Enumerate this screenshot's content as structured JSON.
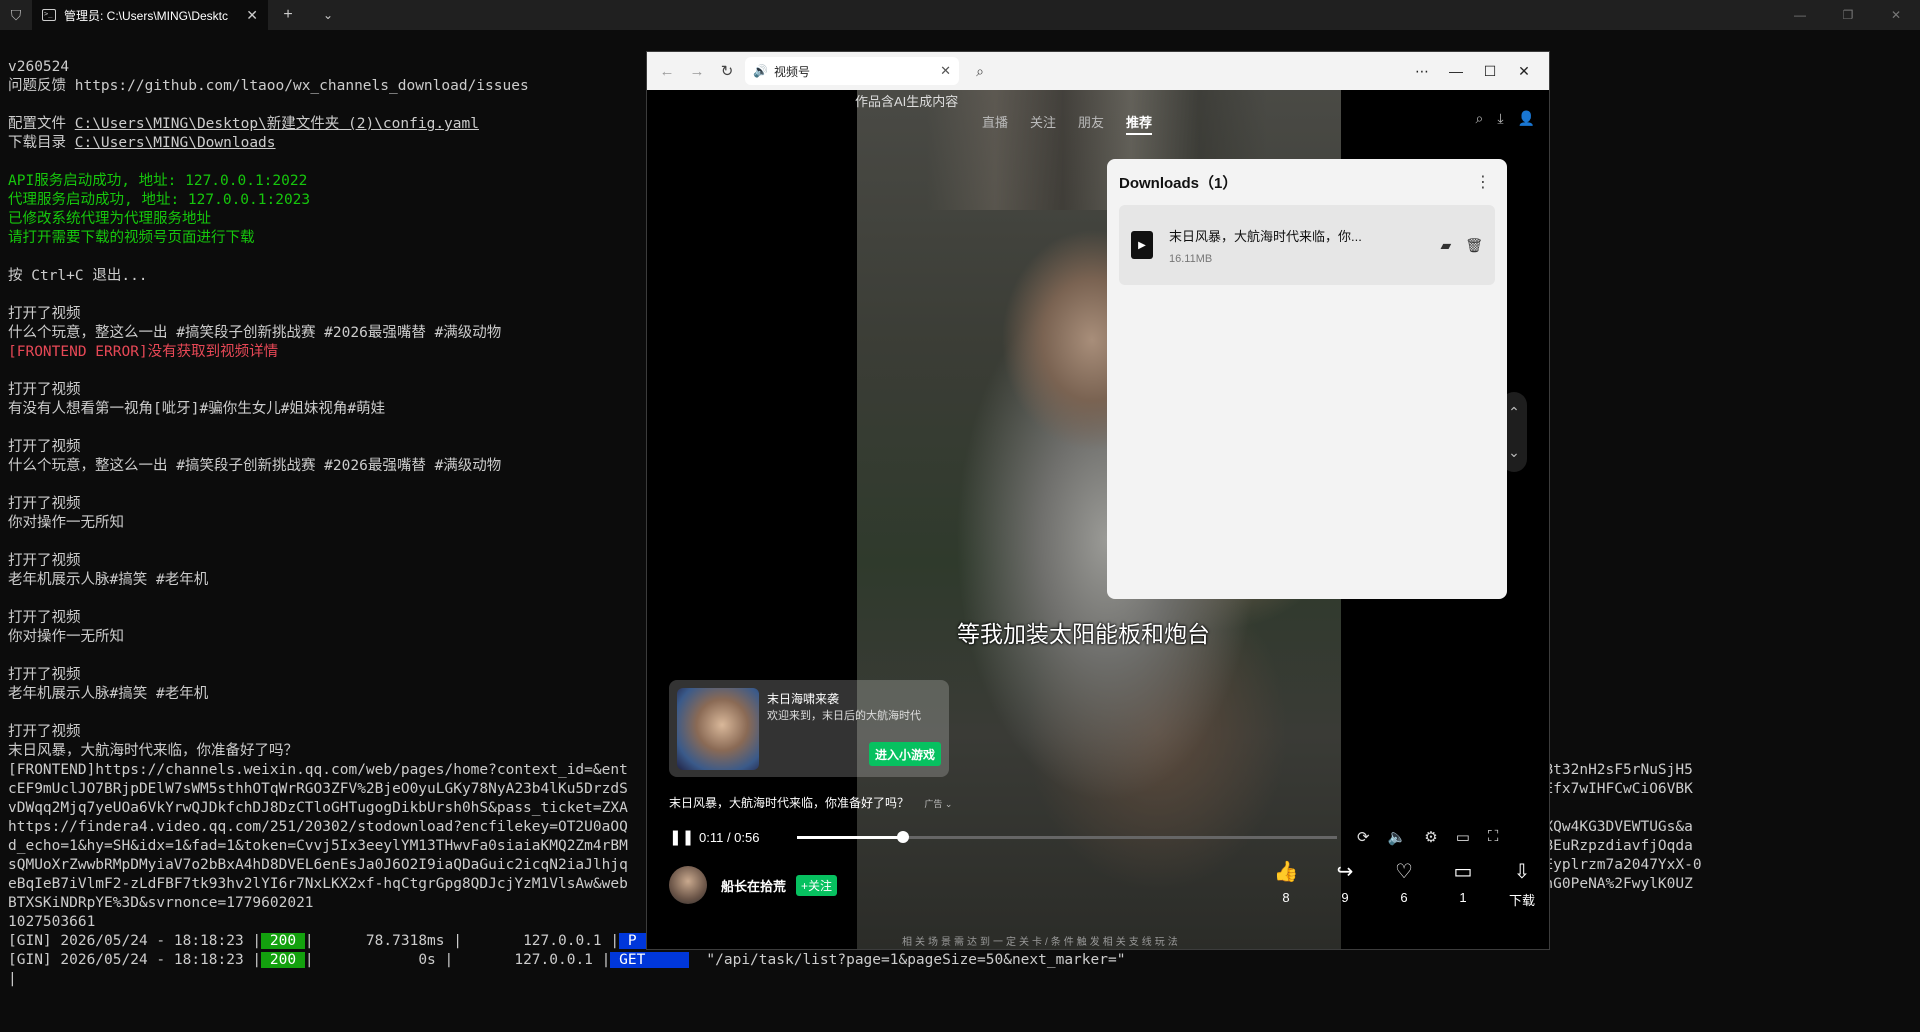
{
  "terminal": {
    "tab_title": "管理员: C:\\Users\\MING\\Desktc",
    "lines": [
      {
        "text": "v260524",
        "cls": ""
      },
      {
        "text": "问题反馈 https://github.com/ltaoo/wx_channels_download/issues",
        "cls": ""
      },
      {
        "text": "",
        "cls": ""
      },
      {
        "text": "配置文件 C:\\Users\\MING\\Desktop\\新建文件夹 (2)\\config.yaml",
        "cls": "",
        "prefix": "配置文件 ",
        "u": "C:\\Users\\MING\\Desktop\\新建文件夹 (2)\\config.yaml"
      },
      {
        "text": "下载目录 C:\\Users\\MING\\Downloads",
        "cls": "",
        "prefix": "下载目录 ",
        "u": "C:\\Users\\MING\\Downloads"
      },
      {
        "text": "",
        "cls": ""
      },
      {
        "text": "API服务启动成功, 地址: 127.0.0.1:2022",
        "cls": "green"
      },
      {
        "text": "代理服务启动成功, 地址: 127.0.0.1:2023",
        "cls": "green"
      },
      {
        "text": "已修改系统代理为代理服务地址",
        "cls": "green"
      },
      {
        "text": "请打开需要下载的视频号页面进行下载",
        "cls": "green"
      },
      {
        "text": "",
        "cls": ""
      },
      {
        "text": "按 Ctrl+C 退出...",
        "cls": ""
      },
      {
        "text": "",
        "cls": ""
      },
      {
        "text": "打开了视频",
        "cls": ""
      },
      {
        "text": "什么个玩意，整这么一出 #搞笑段子创新挑战赛 #2026最强嘴替 #满级动物",
        "cls": ""
      },
      {
        "text": "[FRONTEND ERROR]没有获取到视频详情",
        "cls": "red"
      },
      {
        "text": "",
        "cls": ""
      },
      {
        "text": "打开了视频",
        "cls": ""
      },
      {
        "text": "有没有人想看第一视角[呲牙]#骗你生女儿#姐妹视角#萌娃",
        "cls": ""
      },
      {
        "text": "",
        "cls": ""
      },
      {
        "text": "打开了视频",
        "cls": ""
      },
      {
        "text": "什么个玩意，整这么一出 #搞笑段子创新挑战赛 #2026最强嘴替 #满级动物",
        "cls": ""
      },
      {
        "text": "",
        "cls": ""
      },
      {
        "text": "打开了视频",
        "cls": ""
      },
      {
        "text": "你对操作一无所知",
        "cls": ""
      },
      {
        "text": "",
        "cls": ""
      },
      {
        "text": "打开了视频",
        "cls": ""
      },
      {
        "text": "老年机展示人脉#搞笑 #老年机",
        "cls": ""
      },
      {
        "text": "",
        "cls": ""
      },
      {
        "text": "打开了视频",
        "cls": ""
      },
      {
        "text": "你对操作一无所知",
        "cls": ""
      },
      {
        "text": "",
        "cls": ""
      },
      {
        "text": "打开了视频",
        "cls": ""
      },
      {
        "text": "老年机展示人脉#搞笑 #老年机",
        "cls": ""
      },
      {
        "text": "",
        "cls": ""
      },
      {
        "text": "打开了视频",
        "cls": ""
      },
      {
        "text": "末日风暴，大航海时代来临，你准备好了吗？",
        "cls": ""
      },
      {
        "text": "[FRONTEND]https://channels.weixin.qq.com/web/pages/home?context_id=&ent                                                                                    cz9gKNyK89dVj0NoUi3%2Bt32nH2sF5rNuSjH5",
        "cls": ""
      },
      {
        "text": "cEF9mUclJO7BRjpDElW7sWM5sthhOTqWrRGO3ZFV%2BjeO0yuLGKy78NyA23b4lKu5DrzdS                                                                                    %2BAl4yMgZ9UIJqmETUEUEfx7wIHFCwCiO6VBK",
        "cls": ""
      },
      {
        "text": "vDWqq2Mjq7yeUOa6VkYrwQJDkfchDJ8DzCTloGHTugogDikbUrsh0hS&pass_ticket=ZXA                                                                                    _header=0",
        "cls": ""
      },
      {
        "text": "https://findera4.video.qq.com/251/20302/stodownload?encfilekey=OT2U0aOQ                                                                                    icKucBBBpBlajfHGRuF2dXQw4KG3DVEWTUGs&a",
        "cls": ""
      },
      {
        "text": "d_echo=1&hy=SH&idx=1&fad=1&token=Cvvj5Ix3eeylYM13THwvFa0siaiaKMQ2Zm4rBM                                                                                    9n1elQyWyw5moxb85LRZhBEuRzpzdiavfjOqda",
        "cls": ""
      },
      {
        "text": "sQMUoXrZwwbRMpDMyiaV7o2bBxA4hD8DVEL6enEsJa0J6O2I9iaQDaGuic2icqN2iaJlhjq                                                                                     cKA3hBMhAAMAE&sign=gEyplrzm7a2047YxX-0",
        "cls": ""
      },
      {
        "text": "eBqIeB7iVlmF2-zLdFBF7tk93hv2lYI6r7NxLKX2xf-hqCtgrGpg8QDJcjYzM1VlsAw&web                                                                                    V%2BZpRQB2Md7AaeViAuUhG0PeNA%2FwylK0UZ",
        "cls": ""
      },
      {
        "text": "BTXSKiNDRpYE%3D&svrnonce=1779602021",
        "cls": ""
      },
      {
        "text": "1027503661",
        "cls": ""
      }
    ],
    "gin": [
      {
        "prefix": "[GIN] 2026/05/24 - 18:18:23 |",
        "status": " 200 ",
        "mid": "|      78.7318ms |       127.0.0.1 |",
        "method": " P     ",
        "tail": ""
      },
      {
        "prefix": "[GIN] 2026/05/24 - 18:18:23 |",
        "status": " 200 ",
        "mid": "|            0s |       127.0.0.1 |",
        "method": " GET     ",
        "tail": "  \"/api/task/list?page=1&pageSize=50&next_marker=\""
      }
    ],
    "cursor": "|"
  },
  "browser": {
    "tab_title": "视频号",
    "ai_notice": "作品含AI生成内容",
    "tabs": [
      "直播",
      "关注",
      "朋友",
      "推荐"
    ],
    "active_tab": "推荐",
    "subtitle": "等我加装太阳能板和炮台",
    "downloads": {
      "title": "Downloads（1）",
      "item_name": "末日风暴，大航海时代来临，你...",
      "item_size": "16.11MB"
    },
    "ad": {
      "title": "末日海啸来袭",
      "desc": "欢迎来到，末日后的大航海时代",
      "button": "进入小游戏",
      "caption": "末日风暴，大航海时代来临，你准备好了吗？",
      "tag": "广告 ⌄"
    },
    "player": {
      "time": "0:11 / 0:56",
      "progress": 0.1964
    },
    "author": {
      "name": "船长在拾荒",
      "follow": "+关注"
    },
    "actions": [
      {
        "icon": "thumb-up-icon",
        "glyph": "👍",
        "label": "8"
      },
      {
        "icon": "share-icon",
        "glyph": "↪",
        "label": "9"
      },
      {
        "icon": "heart-icon",
        "glyph": "♡",
        "label": "6"
      },
      {
        "icon": "comment-icon",
        "glyph": "▭",
        "label": "1"
      },
      {
        "icon": "download-icon",
        "glyph": "⇩",
        "label": "下载"
      }
    ],
    "bottom_note": "相关场景需达到一定关卡/条件触发相关支线玩法"
  }
}
